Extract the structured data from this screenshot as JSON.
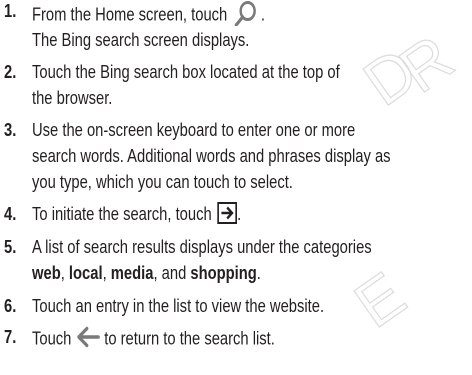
{
  "steps": [
    {
      "number": "1.",
      "line1": {
        "pre": "From the Home screen, touch",
        "post": "."
      },
      "line2": "The Bing search screen displays."
    },
    {
      "number": "2.",
      "line1": "Touch the Bing search box located at the top of",
      "line2": "the browser."
    },
    {
      "number": "3.",
      "line1": "Use the on-screen keyboard to enter one or more",
      "line2": "search words. Additional words and phrases display as",
      "line3": "you type, which you can touch to select."
    },
    {
      "number": "4.",
      "line1": {
        "pre": "To initiate the search, touch",
        "post": "."
      }
    },
    {
      "number": "5.",
      "line1": "A list of search results displays under the categories",
      "line2": {
        "w1": "web",
        "sep1": ", ",
        "w2": "local",
        "sep2": ", ",
        "w3": "media",
        "sep3": ", and ",
        "w4": "shopping",
        "end": "."
      }
    },
    {
      "number": "6.",
      "line1": "Touch an entry in the list to view the website."
    },
    {
      "number": "7.",
      "line1": {
        "pre": "Touch",
        "post": "to return to the search list."
      }
    }
  ],
  "icons": {
    "search": "search-icon",
    "go_arrow": "right-arrow-icon",
    "back_arrow": "back-arrow-icon"
  },
  "colors": {
    "text": "#231f20",
    "watermark": "#d8d8d8"
  },
  "watermark": {
    "char1": "D",
    "char2": "R",
    "char3": "E"
  }
}
